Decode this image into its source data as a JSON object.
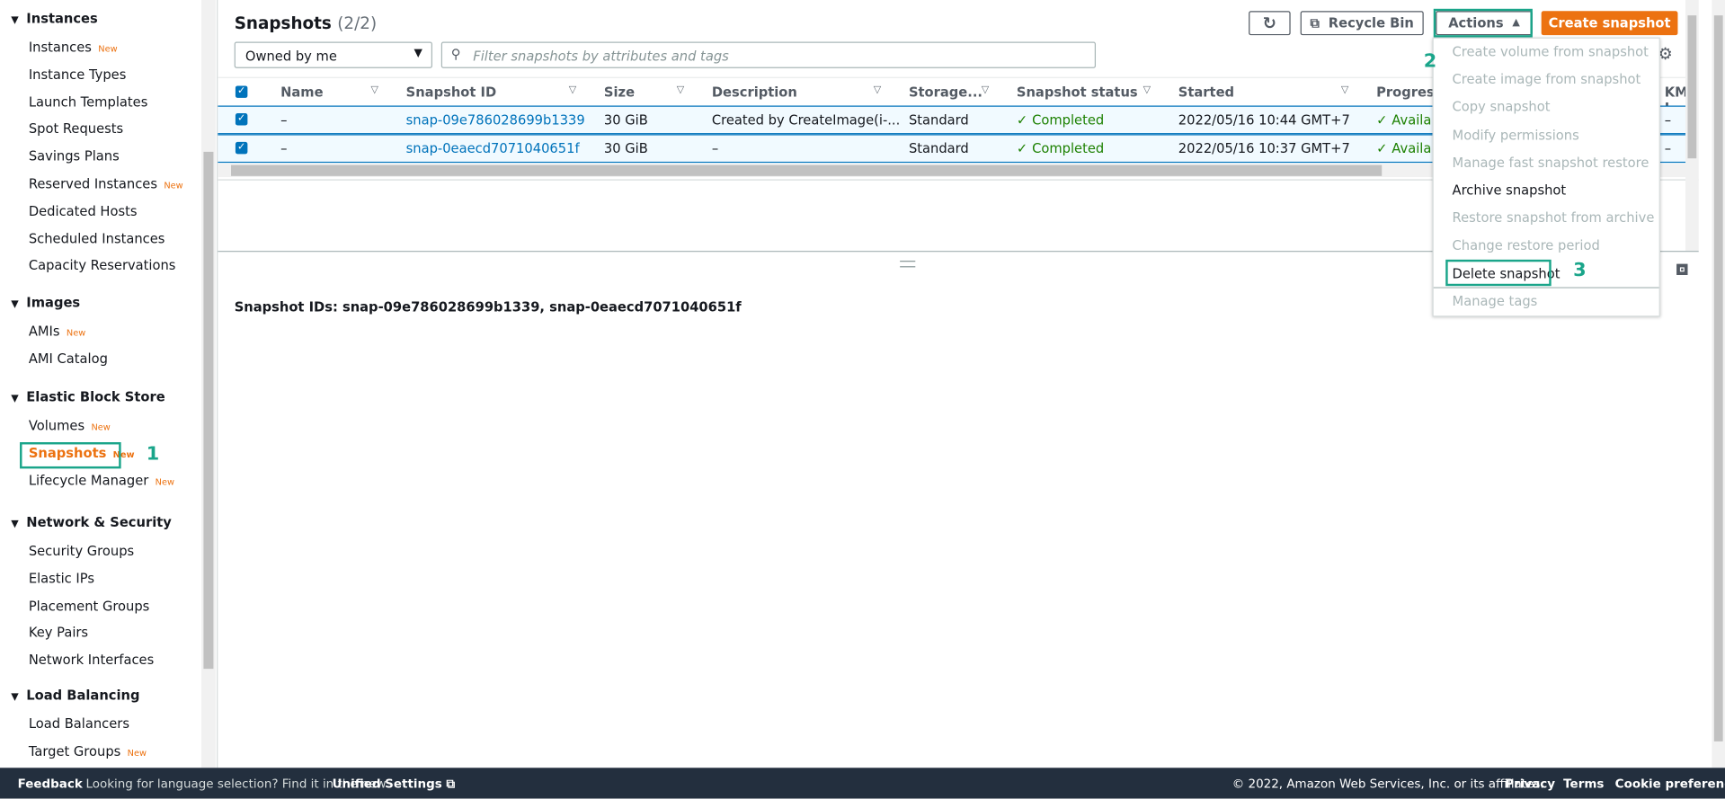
{
  "sidebar": {
    "sections": [
      {
        "title": "Instances",
        "items": [
          {
            "label": "Instances",
            "new": "New"
          },
          {
            "label": "Instance Types"
          },
          {
            "label": "Launch Templates"
          },
          {
            "label": "Spot Requests"
          },
          {
            "label": "Savings Plans"
          },
          {
            "label": "Reserved Instances",
            "new": "New"
          },
          {
            "label": "Dedicated Hosts"
          },
          {
            "label": "Scheduled Instances"
          },
          {
            "label": "Capacity Reservations"
          }
        ]
      },
      {
        "title": "Images",
        "items": [
          {
            "label": "AMIs",
            "new": "New"
          },
          {
            "label": "AMI Catalog"
          }
        ]
      },
      {
        "title": "Elastic Block Store",
        "items": [
          {
            "label": "Volumes",
            "new": "New"
          },
          {
            "label": "Snapshots",
            "new": "New"
          },
          {
            "label": "Lifecycle Manager",
            "new": "New"
          }
        ]
      },
      {
        "title": "Network & Security",
        "items": [
          {
            "label": "Security Groups"
          },
          {
            "label": "Elastic IPs"
          },
          {
            "label": "Placement Groups"
          },
          {
            "label": "Key Pairs"
          },
          {
            "label": "Network Interfaces"
          }
        ]
      },
      {
        "title": "Load Balancing",
        "items": [
          {
            "label": "Load Balancers"
          },
          {
            "label": "Target Groups",
            "new": "New"
          }
        ]
      }
    ]
  },
  "header": {
    "title": "Snapshots",
    "count": "(2/2)",
    "recycle_bin": "Recycle Bin",
    "actions": "Actions",
    "create": "Create snapshot"
  },
  "filter": {
    "owner": "Owned by me",
    "placeholder": "Filter snapshots by attributes and tags"
  },
  "table": {
    "columns": [
      "Name",
      "Snapshot ID",
      "Size",
      "Description",
      "Storage...",
      "Snapshot status",
      "Started",
      "Progress",
      "KMS I"
    ],
    "rows": [
      {
        "name": "–",
        "id": "snap-09e786028699b1339",
        "size": "30 GiB",
        "desc": "Created by CreateImage(i-...",
        "storage": "Standard",
        "status": "Completed",
        "started": "2022/05/16 10:44 GMT+7",
        "progress": "Availab",
        "kms": "–"
      },
      {
        "name": "–",
        "id": "snap-0eaecd7071040651f",
        "size": "30 GiB",
        "desc": "–",
        "storage": "Standard",
        "status": "Completed",
        "started": "2022/05/16 10:37 GMT+7",
        "progress": "Availab",
        "kms": "–"
      }
    ]
  },
  "menu": {
    "items": [
      {
        "label": "Create volume from snapshot",
        "enabled": false
      },
      {
        "label": "Create image from snapshot",
        "enabled": false
      },
      {
        "label": "Copy snapshot",
        "enabled": false
      },
      {
        "label": "Modify permissions",
        "enabled": false
      },
      {
        "label": "Manage fast snapshot restore",
        "enabled": false
      },
      {
        "label": "Archive snapshot",
        "enabled": true
      },
      {
        "label": "Restore snapshot from archive",
        "enabled": false
      },
      {
        "label": "Change restore period",
        "enabled": false
      },
      {
        "label": "Delete snapshot",
        "enabled": true
      },
      {
        "label": "Manage tags",
        "enabled": false
      }
    ]
  },
  "detail": {
    "text": "Snapshot IDs: snap-09e786028699b1339, snap-0eaecd7071040651f"
  },
  "steps": [
    "1",
    "2",
    "3"
  ],
  "footer": {
    "feedback": "Feedback",
    "lang": "Looking for language selection? Find it in the new",
    "unified": "Unified Settings",
    "copyright": "© 2022, Amazon Web Services, Inc. or its affiliates.",
    "privacy": "Privacy",
    "terms": "Terms",
    "cookie": "Cookie preferences"
  },
  "colors": {
    "accent": "#ec7211",
    "link": "#0073bb",
    "success": "#1d8102",
    "highlight": "#1aa58a"
  }
}
